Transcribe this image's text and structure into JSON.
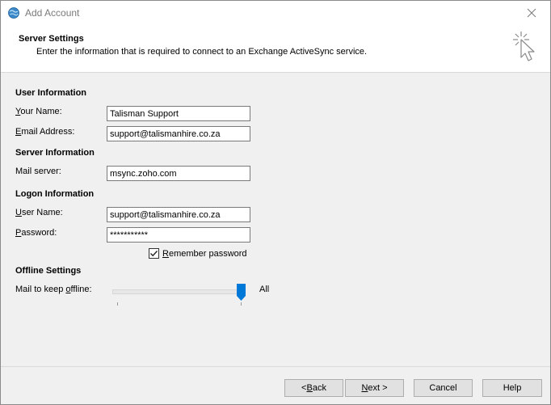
{
  "window": {
    "title": "Add Account"
  },
  "header": {
    "title": "Server Settings",
    "subtitle": "Enter the information that is required to connect to an Exchange ActiveSync service."
  },
  "user_info": {
    "section": "User Information",
    "name_label_accel": "Y",
    "name_label_rest": "our Name:",
    "name_value": "Talisman Support",
    "email_label_accel": "E",
    "email_label_rest": "mail Address:",
    "email_value": "support@talismanhire.co.za"
  },
  "server_info": {
    "section": "Server Information",
    "mail_server_label": "Mail server:",
    "mail_server_value": "msync.zoho.com"
  },
  "logon_info": {
    "section": "Logon Information",
    "username_label_accel": "U",
    "username_label_rest": "ser Name:",
    "username_value": "support@talismanhire.co.za",
    "password_label_accel": "P",
    "password_label_rest": "assword:",
    "password_value": "***********",
    "remember_label_accel": "R",
    "remember_label_rest": "emember password",
    "remember_checked": true
  },
  "offline": {
    "section": "Offline Settings",
    "label_prefix": "Mail to keep ",
    "label_accel": "o",
    "label_suffix": "ffline:",
    "value_label": "All",
    "slider_value_fraction": 1.0
  },
  "buttons": {
    "back_prefix": "< ",
    "back_accel": "B",
    "back_rest": "ack",
    "next_accel": "N",
    "next_rest": "ext >",
    "cancel": "Cancel",
    "help": "Help"
  },
  "colors": {
    "accent": "#0078d7"
  }
}
